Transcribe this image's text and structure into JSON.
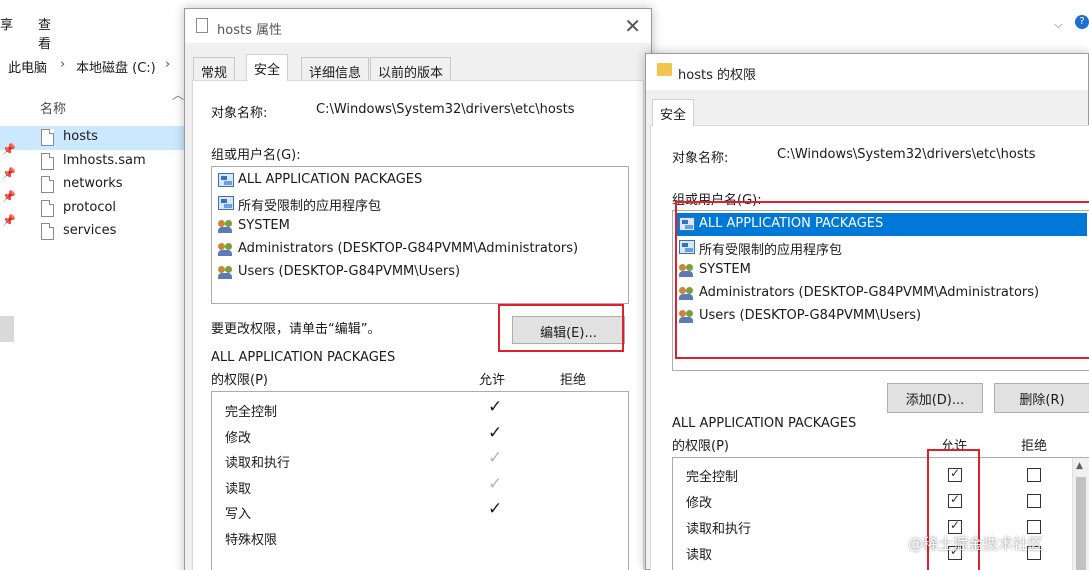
{
  "explorer": {
    "ribbon": {
      "share_partial": "享",
      "view": "查看"
    },
    "breadcrumb": [
      "此电脑",
      "本地磁盘 (C:)"
    ],
    "column_header": "名称",
    "files": [
      {
        "name": "hosts",
        "selected": true
      },
      {
        "name": "lmhosts.sam",
        "selected": false
      },
      {
        "name": "networks",
        "selected": false
      },
      {
        "name": "protocol",
        "selected": false
      },
      {
        "name": "services",
        "selected": false
      }
    ]
  },
  "properties_dialog": {
    "title": "hosts 属性",
    "tabs": [
      "常规",
      "安全",
      "详细信息",
      "以前的版本"
    ],
    "active_tab": "安全",
    "object_name_label": "对象名称:",
    "object_name_value": "C:\\Windows\\System32\\drivers\\etc\\hosts",
    "group_label": "组或用户名(G):",
    "principals": [
      {
        "name": "ALL APPLICATION PACKAGES",
        "icon": "package-icon"
      },
      {
        "name": "所有受限制的应用程序包",
        "icon": "package-icon"
      },
      {
        "name": "SYSTEM",
        "icon": "user-group-icon"
      },
      {
        "name": "Administrators (DESKTOP-G84PVMM\\Administrators)",
        "icon": "user-group-icon"
      },
      {
        "name": "Users (DESKTOP-G84PVMM\\Users)",
        "icon": "user-group-icon"
      }
    ],
    "change_hint": "要更改权限，请单击“编辑”。",
    "edit_button": "编辑(E)...",
    "perm_for_line1": "ALL APPLICATION PACKAGES",
    "perm_for_line2": "的权限(P)",
    "allow_header": "允许",
    "deny_header": "拒绝",
    "permissions": [
      {
        "name": "完全控制",
        "allow": "dark"
      },
      {
        "name": "修改",
        "allow": "dark"
      },
      {
        "name": "读取和执行",
        "allow": "gray"
      },
      {
        "name": "读取",
        "allow": "gray"
      },
      {
        "name": "写入",
        "allow": "dark"
      },
      {
        "name": "特殊权限",
        "allow": ""
      }
    ]
  },
  "permissions_dialog": {
    "title": "hosts 的权限",
    "tab": "安全",
    "object_name_label": "对象名称:",
    "object_name_value": "C:\\Windows\\System32\\drivers\\etc\\hosts",
    "group_label": "组或用户名(G):",
    "principals": [
      {
        "name": "ALL APPLICATION PACKAGES",
        "icon": "package-icon",
        "selected": true
      },
      {
        "name": "所有受限制的应用程序包",
        "icon": "package-icon",
        "selected": false
      },
      {
        "name": "SYSTEM",
        "icon": "user-group-icon",
        "selected": false
      },
      {
        "name": "Administrators (DESKTOP-G84PVMM\\Administrators)",
        "icon": "user-group-icon",
        "selected": false
      },
      {
        "name": "Users (DESKTOP-G84PVMM\\Users)",
        "icon": "user-group-icon",
        "selected": false
      }
    ],
    "add_button": "添加(D)...",
    "remove_button": "删除(R)",
    "perm_for_line1": "ALL APPLICATION PACKAGES",
    "perm_for_line2": "的权限(P)",
    "allow_header": "允许",
    "deny_header": "拒绝",
    "permissions": [
      {
        "name": "完全控制",
        "allow": true,
        "deny": false
      },
      {
        "name": "修改",
        "allow": true,
        "deny": false
      },
      {
        "name": "读取和执行",
        "allow": true,
        "deny": false
      },
      {
        "name": "读取",
        "allow": true,
        "deny": false
      }
    ]
  },
  "watermark": "@稀土掘金技术社区",
  "colors": {
    "highlight": "#0078d7",
    "annotation_red": "#e0202a",
    "selected_file": "#cce8ff"
  }
}
